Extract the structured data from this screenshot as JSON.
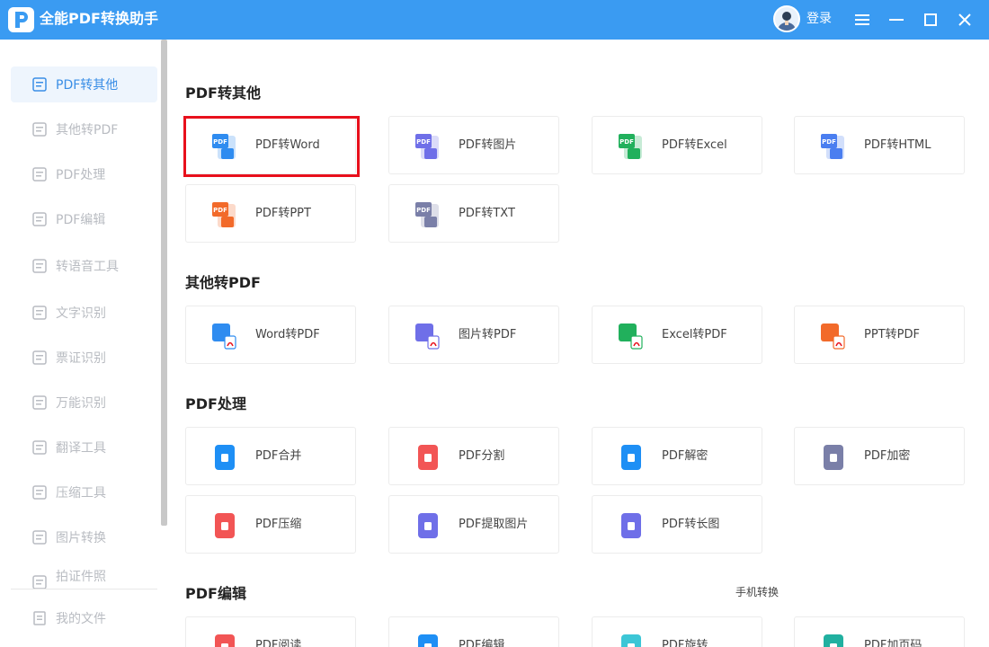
{
  "app": {
    "title": "全能PDF转换助手"
  },
  "header": {
    "login_label": "登录"
  },
  "sidebar": {
    "items": [
      {
        "label": "PDF转其他",
        "active": true
      },
      {
        "label": "其他转PDF"
      },
      {
        "label": "PDF处理"
      },
      {
        "label": "PDF编辑"
      },
      {
        "label": "转语音工具"
      },
      {
        "label": "文字识别"
      },
      {
        "label": "票证识别"
      },
      {
        "label": "万能识别"
      },
      {
        "label": "翻译工具"
      },
      {
        "label": "压缩工具"
      },
      {
        "label": "图片转换"
      },
      {
        "label": "拍证件照"
      }
    ],
    "my_files": "我的文件"
  },
  "sections": [
    {
      "title": "PDF转其他",
      "cards": [
        {
          "label": "PDF转Word",
          "icon": "pdf-to-word-icon",
          "color": "#2f8cf0"
        },
        {
          "label": "PDF转图片",
          "icon": "pdf-to-image-icon",
          "color": "#6f6fe8"
        },
        {
          "label": "PDF转Excel",
          "icon": "pdf-to-excel-icon",
          "color": "#21b05c"
        },
        {
          "label": "PDF转HTML",
          "icon": "pdf-to-html-icon",
          "color": "#4a7ef0"
        },
        {
          "label": "PDF转PPT",
          "icon": "pdf-to-ppt-icon",
          "color": "#f26a2a"
        },
        {
          "label": "PDF转TXT",
          "icon": "pdf-to-txt-icon",
          "color": "#7a7fa8"
        }
      ]
    },
    {
      "title": "其他转PDF",
      "cards": [
        {
          "label": "Word转PDF",
          "icon": "word-to-pdf-icon",
          "color": "#2f8cf0"
        },
        {
          "label": "图片转PDF",
          "icon": "image-to-pdf-icon",
          "color": "#6f6fe8"
        },
        {
          "label": "Excel转PDF",
          "icon": "excel-to-pdf-icon",
          "color": "#21b05c"
        },
        {
          "label": "PPT转PDF",
          "icon": "ppt-to-pdf-icon",
          "color": "#f26a2a"
        }
      ]
    },
    {
      "title": "PDF处理",
      "cards": [
        {
          "label": "PDF合并",
          "icon": "pdf-merge-icon",
          "color": "#1e8ff5"
        },
        {
          "label": "PDF分割",
          "icon": "pdf-split-icon",
          "color": "#f25555"
        },
        {
          "label": "PDF解密",
          "icon": "pdf-decrypt-icon",
          "color": "#1e8ff5"
        },
        {
          "label": "PDF加密",
          "icon": "pdf-encrypt-icon",
          "color": "#7a7fa8"
        },
        {
          "label": "PDF压缩",
          "icon": "pdf-compress-icon",
          "color": "#f25555"
        },
        {
          "label": "PDF提取图片",
          "icon": "pdf-extract-image-icon",
          "color": "#6f6fe8"
        },
        {
          "label": "PDF转长图",
          "icon": "pdf-long-image-icon",
          "color": "#6f6fe8"
        }
      ]
    },
    {
      "title": "PDF编辑",
      "cards": [
        {
          "label": "PDF阅读",
          "icon": "pdf-read-icon",
          "color": "#f25555"
        },
        {
          "label": "PDF编辑",
          "icon": "pdf-edit-icon",
          "color": "#1e8ff5"
        },
        {
          "label": "PDF旋转",
          "icon": "pdf-rotate-icon",
          "color": "#3cc6d6"
        },
        {
          "label": "PDF加页码",
          "icon": "pdf-page-number-icon",
          "color": "#21b0a0"
        }
      ]
    }
  ],
  "phone_convert": "手机转换"
}
